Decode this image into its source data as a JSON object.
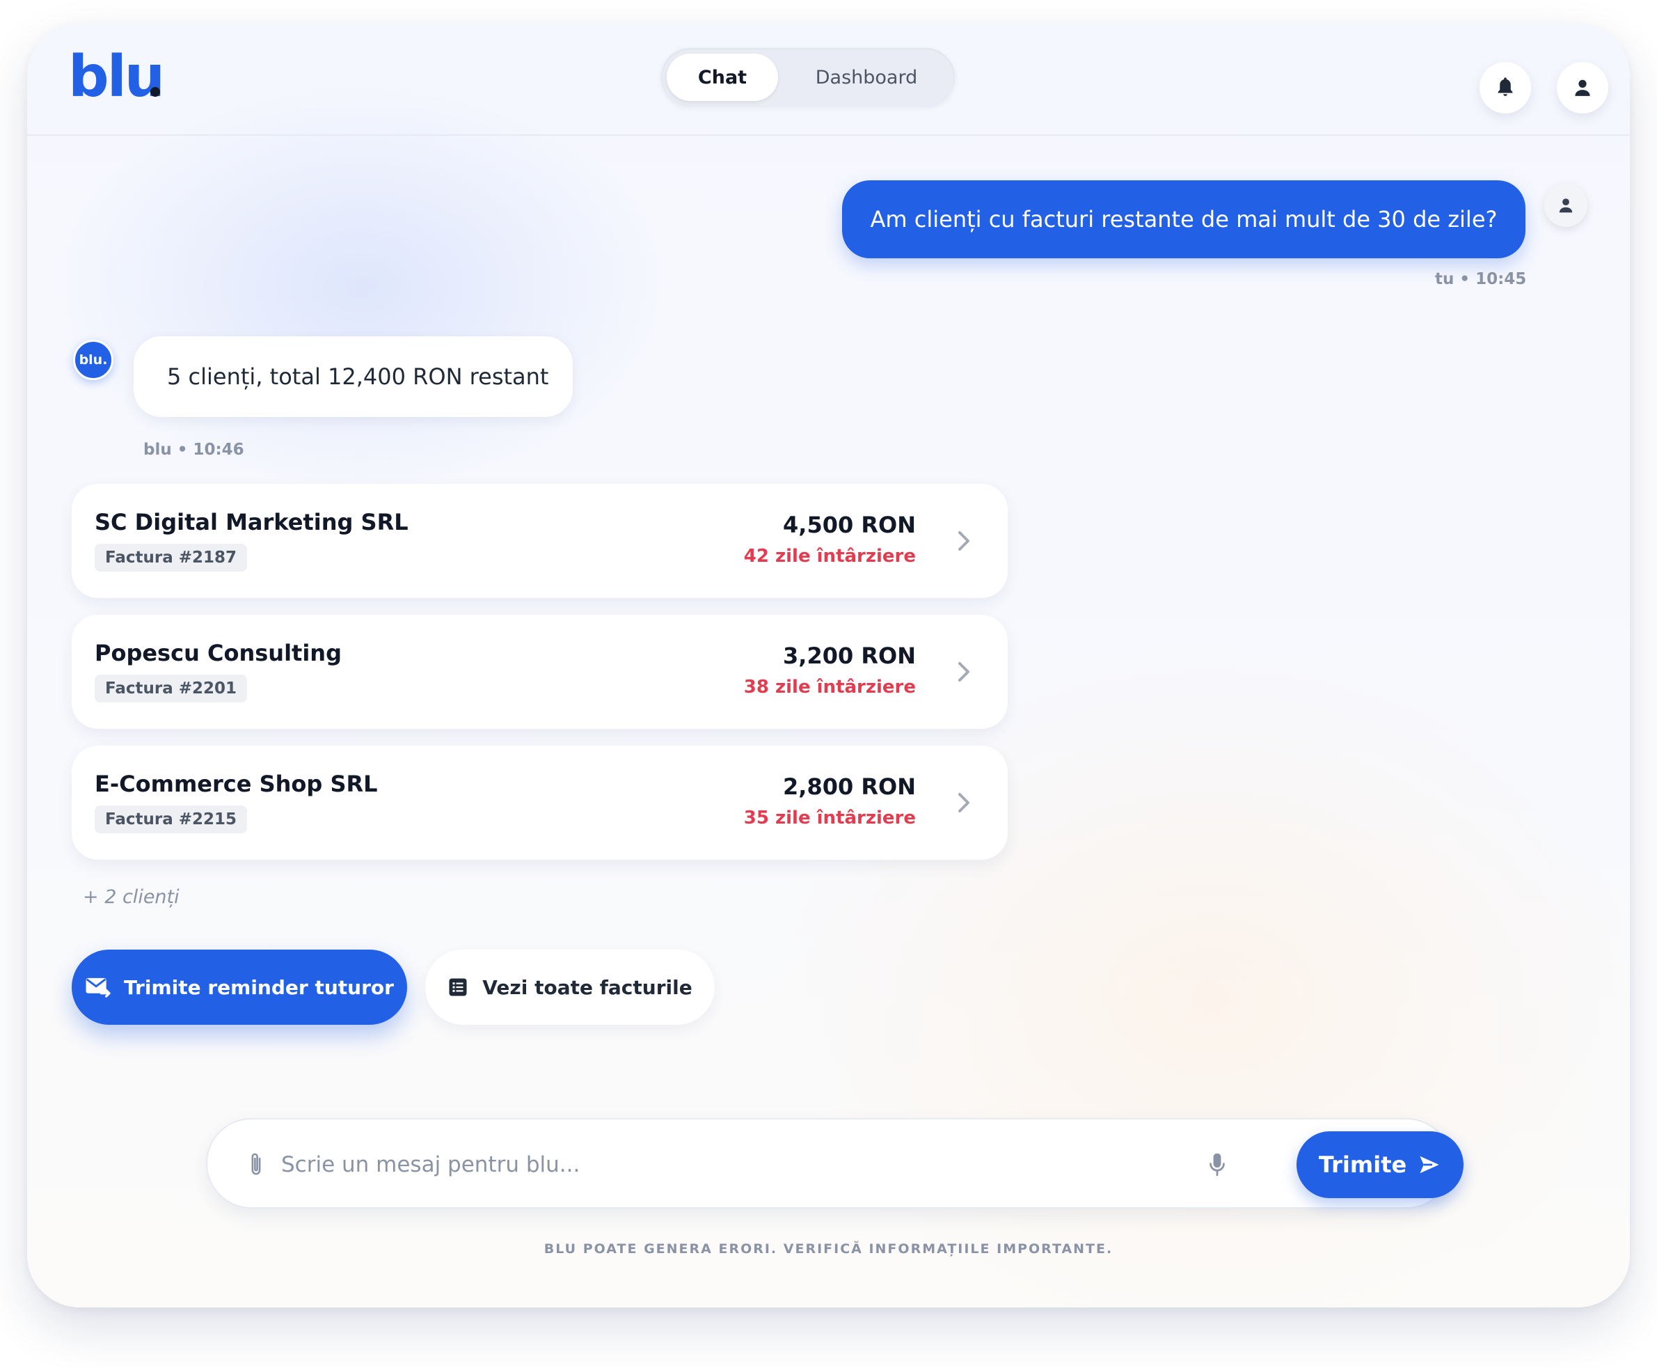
{
  "app": {
    "logo_text": "blu",
    "brand_color": "#2260e6"
  },
  "header": {
    "tabs": [
      {
        "label": "Chat",
        "active": true
      },
      {
        "label": "Dashboard",
        "active": false
      }
    ],
    "icons": [
      "bell-icon",
      "user-icon"
    ]
  },
  "chat": {
    "user_message": {
      "text": "Am clienți cu facturi restante de mai mult de 30 de zile?",
      "meta": "tu • 10:45"
    },
    "bot_message": {
      "avatar_text": "blu.",
      "text": "5 clienți, total 12,400 RON restant",
      "meta": "blu • 10:46"
    },
    "invoices": [
      {
        "client": "SC Digital Marketing SRL",
        "invoice": "Factura #2187",
        "amount": "4,500 RON",
        "overdue": "42 zile întârziere"
      },
      {
        "client": "Popescu Consulting",
        "invoice": "Factura #2201",
        "amount": "3,200 RON",
        "overdue": "38 zile întârziere"
      },
      {
        "client": "E-Commerce Shop SRL",
        "invoice": "Factura #2215",
        "amount": "2,800 RON",
        "overdue": "35 zile întârziere"
      }
    ],
    "more_label": "+ 2 clienți",
    "actions": {
      "primary_label": "Trimite reminder tuturor",
      "secondary_label": "Vezi toate facturile"
    }
  },
  "composer": {
    "placeholder": "Scrie un mesaj pentru blu...",
    "value": "",
    "send_label": "Trimite"
  },
  "footer": {
    "disclaimer": "BLU POATE GENERA ERORI. VERIFICĂ INFORMAȚIILE IMPORTANTE."
  },
  "colors": {
    "accent": "#2260e6",
    "overdue": "#e23c50"
  }
}
